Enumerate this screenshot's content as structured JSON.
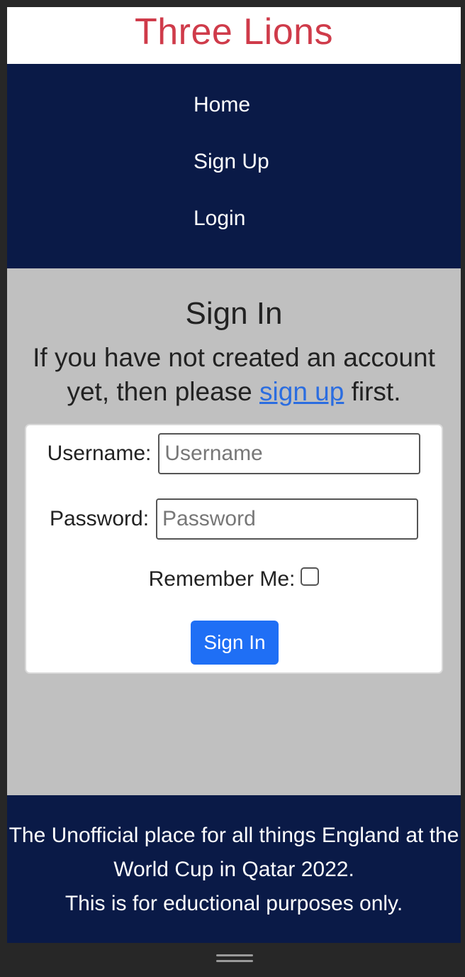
{
  "brand": {
    "title": "Three Lions"
  },
  "nav": {
    "items": [
      {
        "label": "Home"
      },
      {
        "label": "Sign Up"
      },
      {
        "label": "Login"
      }
    ]
  },
  "main": {
    "title": "Sign In",
    "intro_before": "If you have not created an account yet, then please ",
    "intro_link": "sign up",
    "intro_after": " first."
  },
  "form": {
    "username_label": "Username:",
    "username_placeholder": "Username",
    "username_value": "",
    "password_label": "Password:",
    "password_placeholder": "Password",
    "password_value": "",
    "remember_label": "Remember Me:",
    "remember_checked": false,
    "submit_label": "Sign In"
  },
  "footer": {
    "line1": "The Unofficial place for all things England at the World Cup in Qatar 2022.",
    "line2": "This is for eductional purposes only."
  },
  "colors": {
    "brand_red": "#cf3b4a",
    "navy": "#0a1a47",
    "page_grey": "#c0c0c0",
    "link_blue": "#2b6de0",
    "button_blue": "#1f6ff5"
  }
}
